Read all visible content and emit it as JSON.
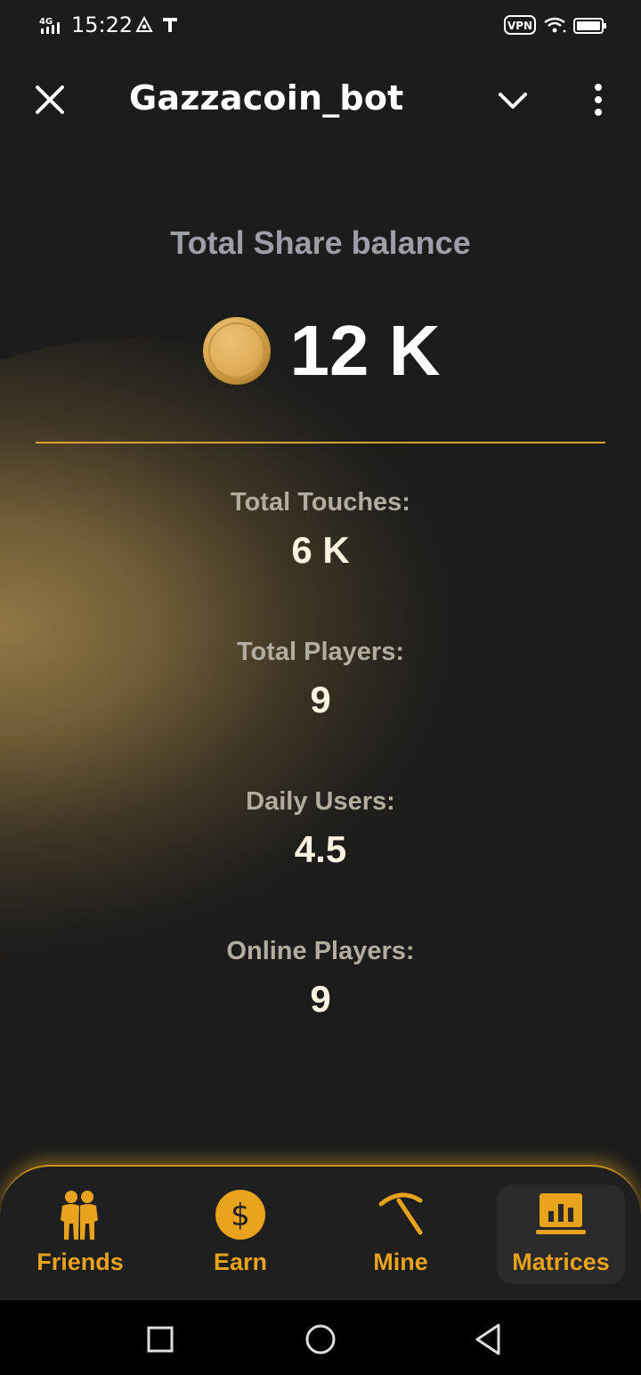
{
  "status_bar": {
    "network": "4G",
    "time": "15:22",
    "vpn": "VPN",
    "icons": [
      "signal-icon",
      "navigation-icon",
      "t-icon",
      "vpn-icon",
      "wifi-icon",
      "battery-icon"
    ]
  },
  "header": {
    "title": "Gazzacoin_bot",
    "icons": [
      "close-icon",
      "chevron-down-icon",
      "more-vertical-icon"
    ]
  },
  "balance": {
    "label": "Total Share balance",
    "value": "12 K",
    "icon": "coin-icon"
  },
  "stats": [
    {
      "label": "Total Touches:",
      "value": "6 K"
    },
    {
      "label": "Total Players:",
      "value": "9"
    },
    {
      "label": "Daily Users:",
      "value": "4.5"
    },
    {
      "label": "Online Players:",
      "value": "9"
    }
  ],
  "nav": {
    "items": [
      {
        "label": "Friends",
        "icon": "friends-icon"
      },
      {
        "label": "Earn",
        "icon": "dollar-coin-icon"
      },
      {
        "label": "Mine",
        "icon": "pickaxe-icon"
      },
      {
        "label": "Matrices",
        "icon": "chart-icon",
        "active": true
      }
    ]
  },
  "colors": {
    "accent": "#e8a21c",
    "background": "#1c1c1c",
    "divider": "#d8a12a"
  }
}
